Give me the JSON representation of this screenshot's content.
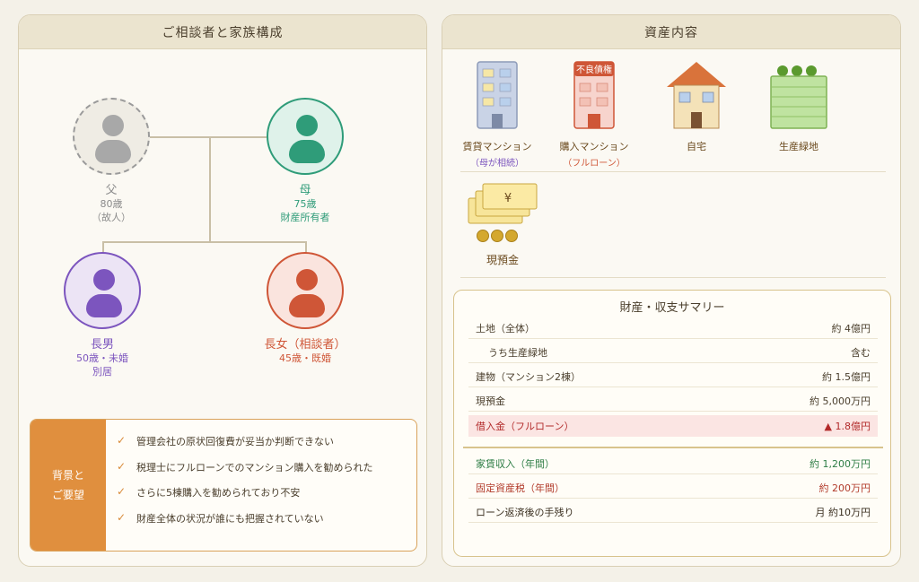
{
  "left_panel": {
    "title": "ご相談者と家族構成",
    "father": {
      "name": "父",
      "age": "80歳",
      "note": "（故人）"
    },
    "mother": {
      "name": "母",
      "age": "75歳",
      "note": "財産所有者"
    },
    "son": {
      "name": "長男",
      "age": "50歳・未婚",
      "note": "別居"
    },
    "daughter": {
      "name": "長女（相談者）",
      "age": "45歳・既婚"
    },
    "background": {
      "label_line1": "背景と",
      "label_line2": "ご要望",
      "items": [
        "管理会社の原状回復費が妥当か判断できない",
        "税理士にフルローンでのマンション購入を勧められた",
        "さらに5棟購入を勧められており不安",
        "財産全体の状況が誰にも把握されていない"
      ]
    }
  },
  "right_panel": {
    "title": "資産内容",
    "assets": [
      {
        "label": "賃貸マンション",
        "sub": "（母が相続）"
      },
      {
        "label": "購入マンション",
        "sub": "（フルローン）",
        "sign": "不良債権"
      },
      {
        "label": "自宅"
      },
      {
        "label": "生産緑地"
      },
      {
        "label": "現預金",
        "symbol": "¥"
      }
    ],
    "summary": {
      "title": "財産・収支サマリー",
      "rows": [
        {
          "label": "土地（全体）",
          "value": "約 4億円"
        },
        {
          "label": "うち生産緑地",
          "value": "含む"
        },
        {
          "label": "建物（マンション2棟）",
          "value": "約 1.5億円"
        },
        {
          "label": "現預金",
          "value": "約 5,000万円"
        },
        {
          "label": "借入金（フルローン）",
          "value": "▲ 1.8億円"
        }
      ],
      "income_rows": [
        {
          "label": "家賃収入（年間）",
          "value": "約 1,200万円"
        },
        {
          "label": "固定資産税（年間）",
          "value": "約 200万円"
        },
        {
          "label": "ローン返済後の手残り",
          "value": "月 約10万円"
        }
      ]
    }
  },
  "colors": {
    "mother": "#2f9c79",
    "son": "#7c55be",
    "daughter": "#cf5637",
    "father": "#a8a8a8",
    "accent": "#e08f3e"
  }
}
